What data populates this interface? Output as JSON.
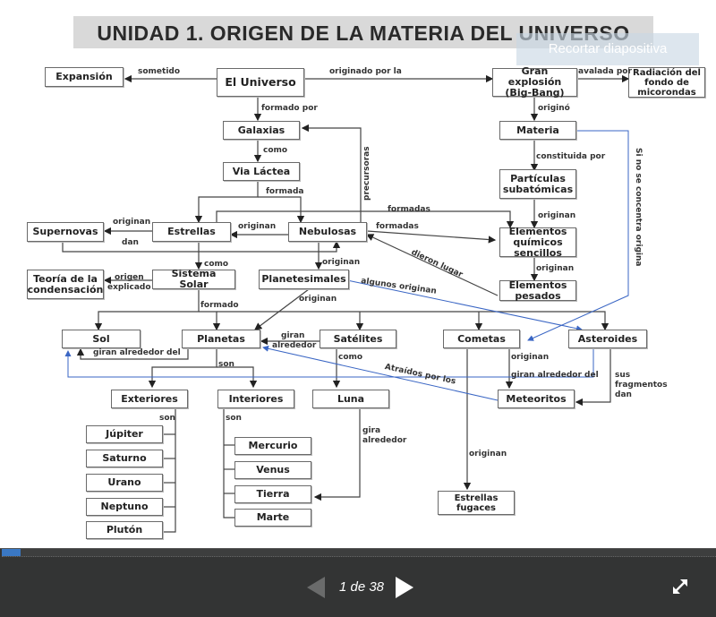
{
  "slide": {
    "title": "UNIDAD 1. ORIGEN DE LA MATERIA DEL UNIVERSO",
    "crop_button_label": "Recortar diapositiva"
  },
  "diagram": {
    "nodes": {
      "expansion": "Expansión",
      "universo": "El Universo",
      "gran_explosion": "Gran explosión (Big-Bang)",
      "radiacion": "Radiación del fondo de micorondas",
      "galaxias": "Galaxias",
      "materia": "Materia",
      "via_lactea": "Via Láctea",
      "particulas": "Partículas subatómicas",
      "supernovas": "Supernovas",
      "estrellas": "Estrellas",
      "nebulosas": "Nebulosas",
      "elementos_quimicos": "Elementos químicos sencillos",
      "teoria": "Teoría de la condensación",
      "sistema_solar": "Sistema Solar",
      "planetesimales": "Planetesimales",
      "elementos_pesados": "Elementos pesados",
      "sol": "Sol",
      "planetas": "Planetas",
      "satelites": "Satélites",
      "cometas": "Cometas",
      "asteroides": "Asteroides",
      "exteriores": "Exteriores",
      "interiores": "Interiores",
      "luna": "Luna",
      "meteoritos": "Meteoritos",
      "jupiter": "Júpiter",
      "saturno": "Saturno",
      "urano": "Urano",
      "neptuno": "Neptuno",
      "pluton": "Plutón",
      "mercurio": "Mercurio",
      "venus": "Venus",
      "tierra": "Tierra",
      "marte": "Marte",
      "estrellas_fugaces": "Estrellas fugaces"
    },
    "links": {
      "sometido": "sometido",
      "originado_por_la": "originado por la",
      "avalada_por": "avalada por",
      "formado_por": "formado por",
      "origino": "originó",
      "como_galaxias": "como",
      "constituida_por": "constituida por",
      "formada": "formada",
      "precursoras": "precursoras",
      "si_no_se_concentra": "Si no se concentra origina",
      "originan_particulas": "originan",
      "formadas_1": "formadas",
      "formadas_2": "formadas",
      "originan_supernovas": "originan",
      "dan": "dan",
      "originan_estrellas": "originan",
      "dieron_lugar": "dieron lugar",
      "originan_pesados": "originan",
      "como_sistema": "como",
      "originan_planetesimales": "originan",
      "origen_explicado_1": "origen",
      "origen_explicado_2": "explicado",
      "algunos_originan": "algunos originan",
      "formado": "formado",
      "originan_planetas": "originan",
      "giran_alrededor_del": "giran alrededor del",
      "giran_alrededor_1": "giran",
      "giran_alrededor_2": "alrededor",
      "son_planetas": "son",
      "como_satelites": "como",
      "atraidos_por_los": "Atraídos por los",
      "originan_meteoritos": "originan",
      "giran_alrededor_del_2": "giran alrededor del",
      "sus_fragmentos_dan_1": "sus",
      "sus_fragmentos_dan_2": "fragmentos",
      "sus_fragmentos_dan_3": "dan",
      "son_exteriores": "son",
      "son_interiores": "son",
      "gira_alrededor_1": "gira",
      "gira_alrededor_2": "alrededor",
      "originan_fugaces": "originan"
    }
  },
  "player": {
    "current_page": 1,
    "total_pages": 38,
    "page_indicator": "1 de 38",
    "progress_fraction": 0.026,
    "accent_color": "#3a78c4",
    "prev_icon": "triangle-left-icon",
    "next_icon": "triangle-right-icon",
    "fullscreen_icon": "expand-arrows-icon"
  }
}
